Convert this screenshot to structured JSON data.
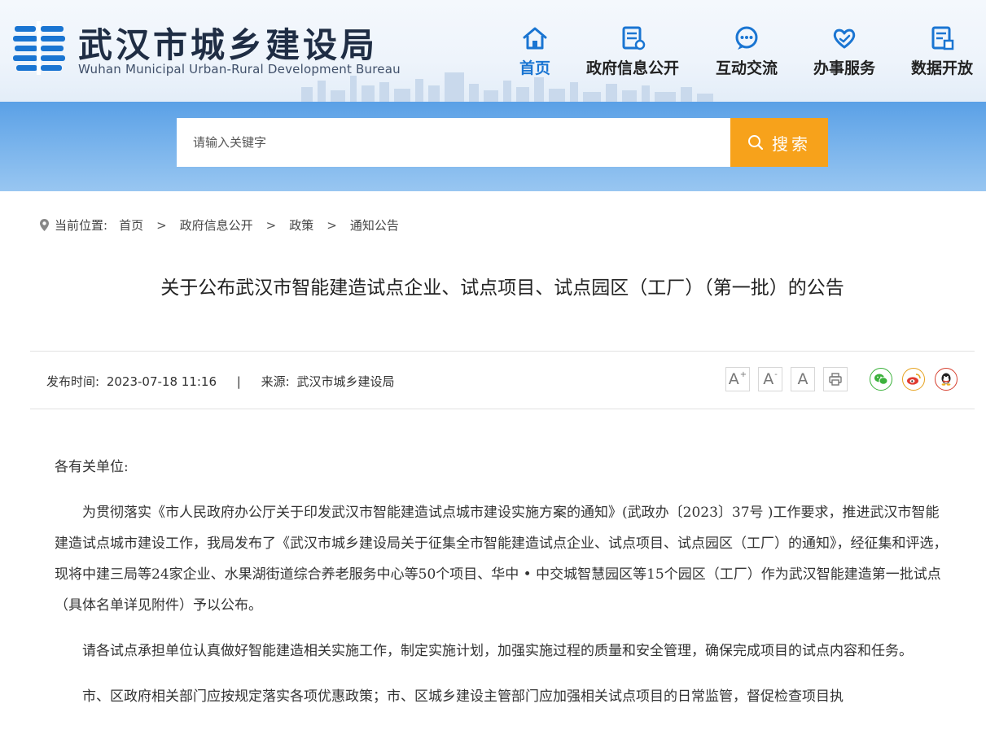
{
  "header": {
    "org_name_cn": "武汉市城乡建设局",
    "org_name_en": "Wuhan Municipal Urban-Rural Development Bureau",
    "nav": [
      {
        "label": "首页",
        "icon": "home-icon",
        "active": true
      },
      {
        "label": "政府信息公开",
        "icon": "document-icon",
        "active": false
      },
      {
        "label": "互动交流",
        "icon": "chat-bubble-icon",
        "active": false
      },
      {
        "label": "办事服务",
        "icon": "heart-hand-icon",
        "active": false
      },
      {
        "label": "数据开放",
        "icon": "data-report-icon",
        "active": false
      }
    ]
  },
  "search": {
    "placeholder": "请输入关键字",
    "button_label": "搜索"
  },
  "breadcrumb": {
    "prefix": "当前位置:",
    "items": [
      "首页",
      "政府信息公开",
      "政策",
      "通知公告"
    ],
    "separator": ">"
  },
  "article": {
    "title": "关于公布武汉市智能建造试点企业、试点项目、试点园区（工厂）（第一批）的公告",
    "meta": {
      "publish_label": "发布时间:",
      "publish_time": "2023-07-18 11:16",
      "divider": "|",
      "source_label": "来源:",
      "source": "武汉市城乡建设局"
    },
    "tools": {
      "font_larger": "A",
      "font_larger_mark": "+",
      "font_smaller": "A",
      "font_smaller_mark": "-",
      "font_reset": "A"
    },
    "paragraphs": [
      "各有关单位:",
      "为贯彻落实《市人民政府办公厅关于印发武汉市智能建造试点城市建设实施方案的通知》(武政办〔2023〕37号 )工作要求，推进武汉市智能建造试点城市建设工作，我局发布了《武汉市城乡建设局关于征集全市智能建造试点企业、试点项目、试点园区（工厂）的通知》，经征集和评选，现将中建三局等24家企业、水果湖街道综合养老服务中心等50个项目、华中 • 中交城智慧园区等15个园区（工厂）作为武汉智能建造第一批试点（具体名单详见附件）予以公布。",
      "请各试点承担单位认真做好智能建造相关实施工作，制定实施计划，加强实施过程的质量和安全管理，确保完成项目的试点内容和任务。",
      "市、区政府相关部门应按规定落实各项优惠政策；市、区城乡建设主管部门应加强相关试点项目的日常监管，督促检查项目执"
    ]
  },
  "colors": {
    "brand_blue": "#1a75d2",
    "search_button": "#f7a21b",
    "wechat": "#3bb13b",
    "weibo": "#e6a21e",
    "qq": "#d6402f"
  }
}
